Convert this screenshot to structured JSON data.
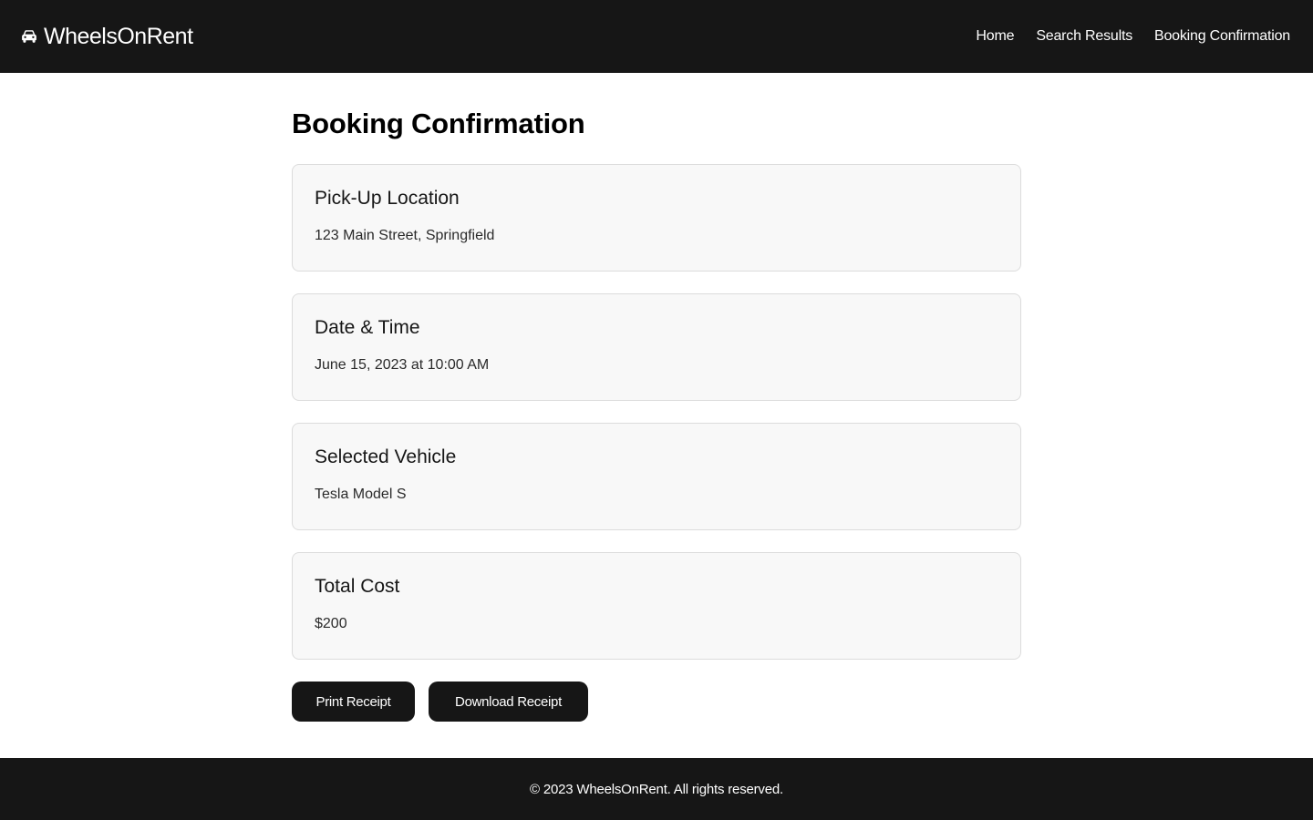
{
  "header": {
    "brand_icon": "car-icon",
    "brand_name": "WheelsOnRent",
    "nav": [
      {
        "label": "Home"
      },
      {
        "label": "Search Results"
      },
      {
        "label": "Booking Confirmation"
      }
    ]
  },
  "main": {
    "title": "Booking Confirmation",
    "cards": [
      {
        "title": "Pick-Up Location",
        "value": "123 Main Street, Springfield"
      },
      {
        "title": "Date & Time",
        "value": "June 15, 2023 at 10:00 AM"
      },
      {
        "title": "Selected Vehicle",
        "value": "Tesla Model S"
      },
      {
        "title": "Total Cost",
        "value": "$200"
      }
    ],
    "actions": {
      "print_label": "Print Receipt",
      "download_label": "Download Receipt"
    }
  },
  "footer": {
    "text": "© 2023 WheelsOnRent. All rights reserved."
  },
  "colors": {
    "header_bg": "#161616",
    "card_bg": "#f8f8f8",
    "card_border": "#dcdcdc",
    "button_bg": "#161616",
    "footer_bg": "#161616"
  }
}
